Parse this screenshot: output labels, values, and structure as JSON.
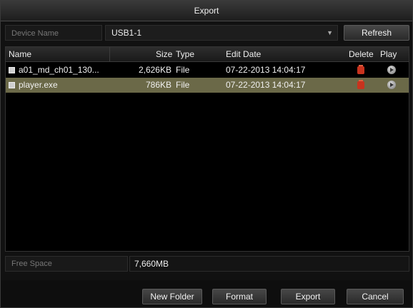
{
  "dialog": {
    "title": "Export"
  },
  "device": {
    "label": "Device Name",
    "selected": "USB1-1",
    "refresh_label": "Refresh"
  },
  "table": {
    "columns": {
      "name": "Name",
      "size": "Size",
      "type": "Type",
      "edit_date": "Edit Date",
      "delete": "Delete",
      "play": "Play"
    },
    "rows": [
      {
        "name": "a01_md_ch01_130...",
        "size": "2,626KB",
        "type": "File",
        "edit_date": "07-22-2013 14:04:17",
        "selected": false
      },
      {
        "name": "player.exe",
        "size": "786KB",
        "type": "File",
        "edit_date": "07-22-2013 14:04:17",
        "selected": true
      }
    ]
  },
  "free_space": {
    "label": "Free Space",
    "value": "7,660MB"
  },
  "footer": {
    "new_folder_label": "New Folder",
    "format_label": "Format",
    "export_label": "Export",
    "cancel_label": "Cancel"
  },
  "icons": {
    "file": "file-icon",
    "delete": "trash-icon",
    "play": "play-icon",
    "dropdown": "chevron-down-icon"
  },
  "colors": {
    "selected_row": "#6b6948",
    "delete_icon": "#c8331e"
  }
}
